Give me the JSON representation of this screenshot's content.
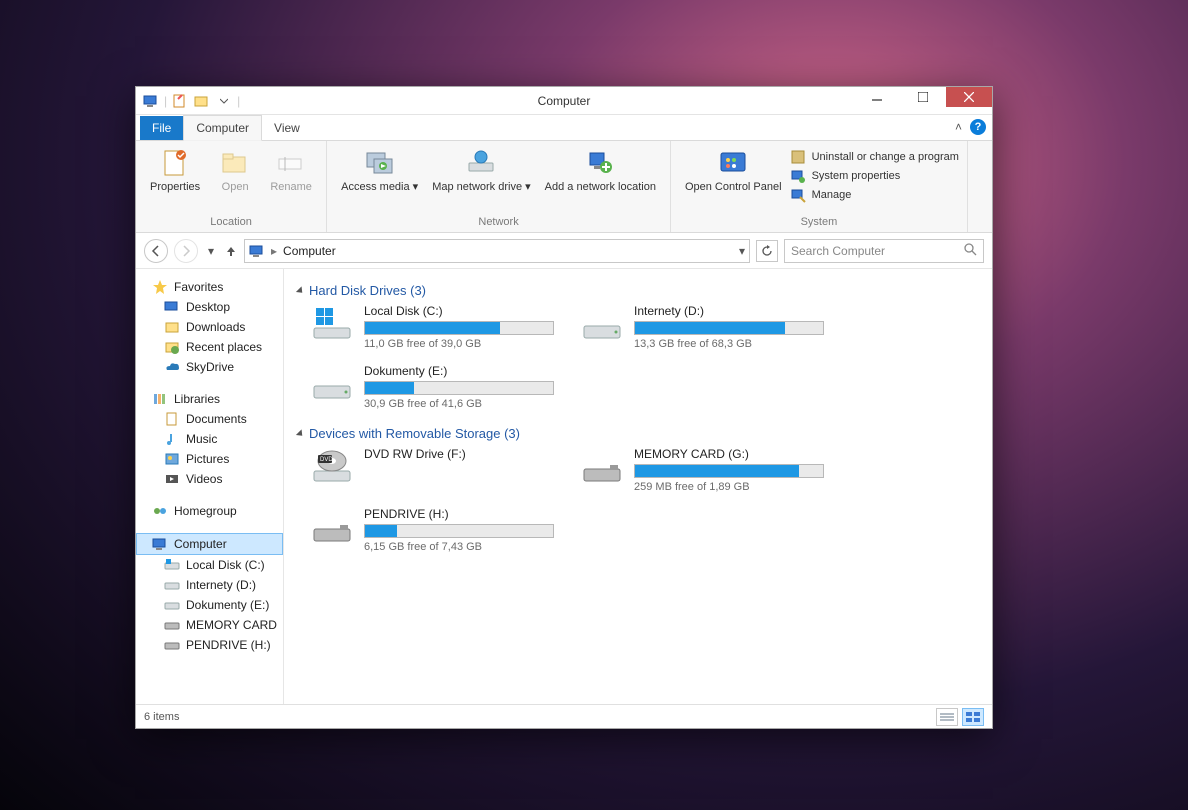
{
  "window": {
    "title": "Computer"
  },
  "tabs": {
    "file": "File",
    "computer": "Computer",
    "view": "View"
  },
  "ribbon": {
    "location": {
      "group": "Location",
      "properties": "Properties",
      "open": "Open",
      "rename": "Rename"
    },
    "network": {
      "group": "Network",
      "access_media": "Access media",
      "map_drive": "Map network drive",
      "add_loc": "Add a network location"
    },
    "system": {
      "group": "System",
      "open_cp": "Open Control Panel",
      "uninstall": "Uninstall or change a program",
      "sysprops": "System properties",
      "manage": "Manage"
    }
  },
  "breadcrumb": {
    "root": "Computer"
  },
  "search": {
    "placeholder": "Search Computer"
  },
  "sidebar": {
    "favorites": {
      "label": "Favorites",
      "items": [
        "Desktop",
        "Downloads",
        "Recent places",
        "SkyDrive"
      ]
    },
    "libraries": {
      "label": "Libraries",
      "items": [
        "Documents",
        "Music",
        "Pictures",
        "Videos"
      ]
    },
    "homegroup": {
      "label": "Homegroup"
    },
    "computer": {
      "label": "Computer",
      "items": [
        "Local Disk (C:)",
        "Internety (D:)",
        "Dokumenty (E:)",
        "MEMORY CARD",
        "PENDRIVE (H:)"
      ]
    }
  },
  "categories": {
    "hdd": {
      "label": "Hard Disk Drives (3)"
    },
    "removable": {
      "label": "Devices with Removable Storage (3)"
    }
  },
  "drives": {
    "hdd": [
      {
        "name": "Local Disk (C:)",
        "free": "11,0 GB free of 39,0 GB",
        "pct": 72
      },
      {
        "name": "Internety (D:)",
        "free": "13,3 GB free of 68,3 GB",
        "pct": 80
      },
      {
        "name": "Dokumenty (E:)",
        "free": "30,9 GB free of 41,6 GB",
        "pct": 26
      }
    ],
    "removable": [
      {
        "name": "DVD RW Drive (F:)",
        "free": "",
        "pct": null
      },
      {
        "name": "MEMORY CARD (G:)",
        "free": "259 MB free of 1,89 GB",
        "pct": 87
      },
      {
        "name": "PENDRIVE (H:)",
        "free": "6,15 GB free of 7,43 GB",
        "pct": 17
      }
    ]
  },
  "status": {
    "count": "6 items"
  }
}
